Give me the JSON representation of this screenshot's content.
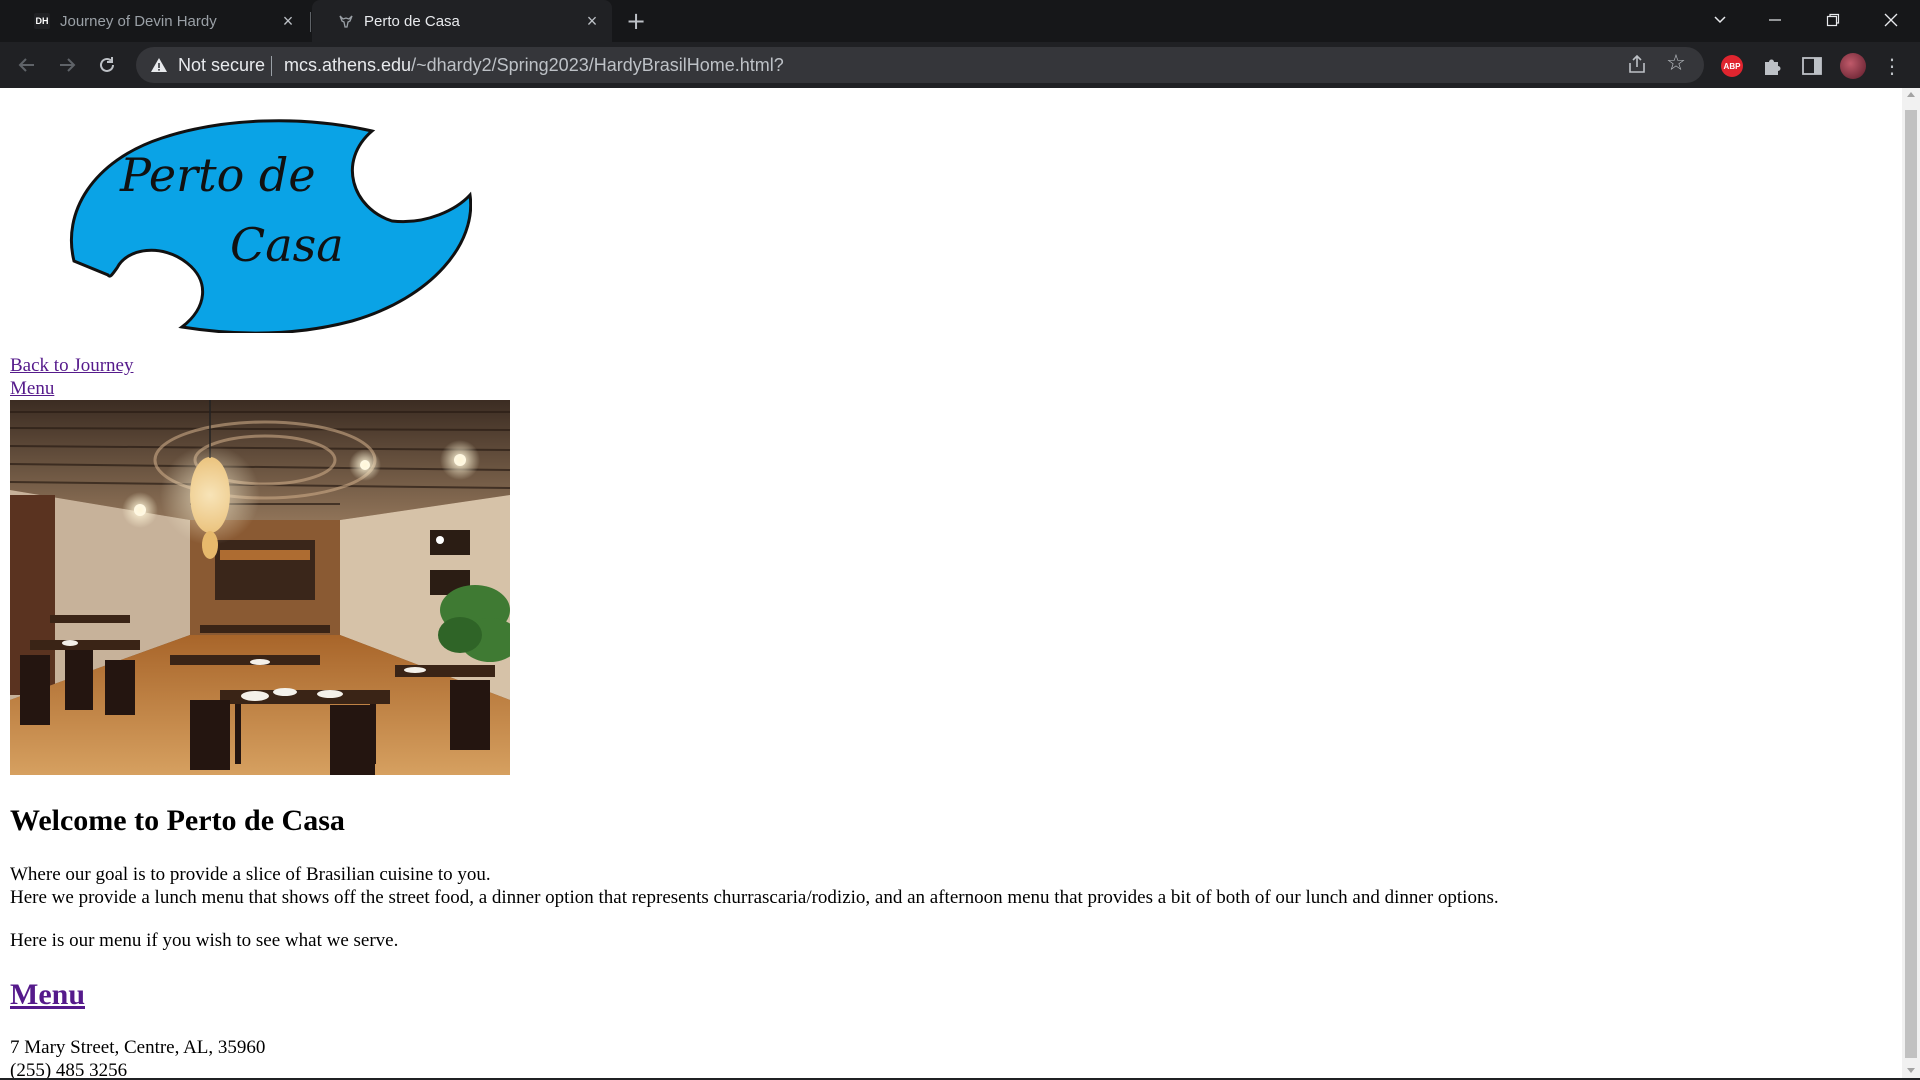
{
  "browser": {
    "tabs": [
      {
        "favicon": "DH",
        "title": "Journey of Devin Hardy",
        "active": false
      },
      {
        "favicon": "bull-icon",
        "title": "Perto de Casa",
        "active": true
      }
    ],
    "address_bar": {
      "security_label": "Not secure",
      "url_host": "mcs.athens.edu",
      "url_path": "/~dhardy2/Spring2023/HardyBrasilHome.html?"
    },
    "extensions": {
      "abp_label": "ABP"
    }
  },
  "page": {
    "logo": {
      "line1": "Perto de",
      "line2": "Casa",
      "color": "#0aa3e6"
    },
    "nav_links": {
      "back": "Back to Journey",
      "menu": "Menu"
    },
    "welcome_heading": "Welcome to Perto de Casa",
    "intro_line1": "Where our goal is to provide a slice of Brasilian cuisine to you.",
    "intro_line2": "Here we provide a lunch menu that shows off the street food, a dinner option that represents churrascaria/rodizio, and an afternoon menu that provides a bit of both of our lunch and dinner options.",
    "menu_prompt": "Here is our menu if you wish to see what we serve.",
    "menu_heading_link": "Menu",
    "address": "7 Mary Street, Centre, AL, 35960",
    "phone": "(255) 485 3256"
  },
  "colors": {
    "link_visited": "#551a8b",
    "chrome_bg": "#202124",
    "tabstrip_bg": "#161719"
  }
}
